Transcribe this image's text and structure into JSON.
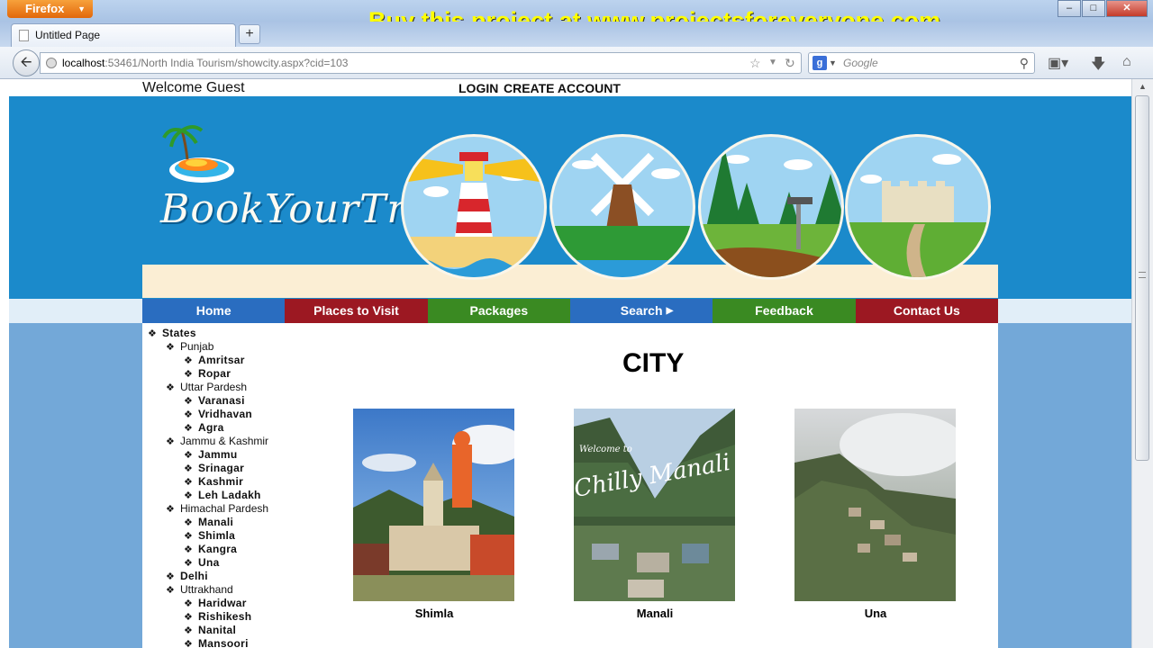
{
  "browser": {
    "menu_button": "Firefox",
    "promo_text": "Buy this project at www.projectsforeveryone.com",
    "tab_title": "Untitled Page",
    "new_tab": "+",
    "url_host": "localhost",
    "url_rest": ":53461/North India Tourism/showcity.aspx?cid=103",
    "search_placeholder": "Google",
    "search_engine_icon": "g"
  },
  "header": {
    "welcome": "Welcome Guest",
    "login": "LOGIN",
    "create_account": "CREATE ACCOUNT",
    "logo_text": "BookYourTrip"
  },
  "menu": [
    {
      "label": "Home",
      "color": "#2a6dc0"
    },
    {
      "label": "Places to Visit",
      "color": "#9c1822"
    },
    {
      "label": "Packages",
      "color": "#3a8a22"
    },
    {
      "label": "Search",
      "color": "#2a6dc0",
      "has_sub": true
    },
    {
      "label": "Feedback",
      "color": "#3a8a22"
    },
    {
      "label": "Contact Us",
      "color": "#9c1822"
    }
  ],
  "tree": {
    "root": "States",
    "items": [
      {
        "label": "Punjab",
        "level": 1
      },
      {
        "label": "Amritsar",
        "level": 2
      },
      {
        "label": "Ropar",
        "level": 2
      },
      {
        "label": "Uttar Pardesh",
        "level": 1
      },
      {
        "label": "Varanasi",
        "level": 2
      },
      {
        "label": "Vridhavan",
        "level": 2
      },
      {
        "label": "Agra",
        "level": 2
      },
      {
        "label": "Jammu & Kashmir",
        "level": 1
      },
      {
        "label": "Jammu",
        "level": 2
      },
      {
        "label": "Srinagar",
        "level": 2
      },
      {
        "label": "Kashmir",
        "level": 2
      },
      {
        "label": "Leh Ladakh",
        "level": 2
      },
      {
        "label": "Himachal Pardesh",
        "level": 1
      },
      {
        "label": "Manali",
        "level": 2
      },
      {
        "label": "Shimla",
        "level": 2
      },
      {
        "label": "Kangra",
        "level": 2
      },
      {
        "label": "Una",
        "level": 2
      },
      {
        "label": "Delhi",
        "level": 1,
        "bold": true
      },
      {
        "label": "Uttrakhand",
        "level": 1
      },
      {
        "label": "Haridwar",
        "level": 2
      },
      {
        "label": "Rishikesh",
        "level": 2
      },
      {
        "label": "Nanital",
        "level": 2
      },
      {
        "label": "Mansoori",
        "level": 2
      }
    ]
  },
  "main": {
    "title": "CITY",
    "cities": [
      {
        "name": "Shimla"
      },
      {
        "name": "Manali",
        "overlay_text": "Welcome to Chilly Manali"
      },
      {
        "name": "Una"
      }
    ]
  },
  "colors": {
    "page_bg": "#73a8d8",
    "banner_blue": "#1b8acb",
    "promo_yellow": "#ffff00"
  }
}
